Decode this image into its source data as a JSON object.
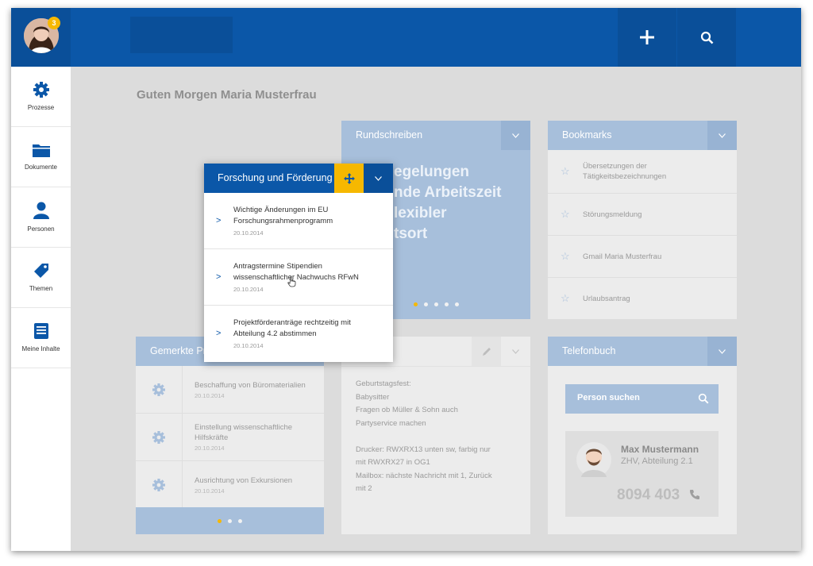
{
  "header": {
    "notification_count": "3",
    "add_icon": "plus-icon",
    "search_icon": "search-icon"
  },
  "sidebar": {
    "items": [
      {
        "label": "Prozesse",
        "icon": "gear-icon"
      },
      {
        "label": "Dokumente",
        "icon": "folder-icon"
      },
      {
        "label": "Personen",
        "icon": "person-icon"
      },
      {
        "label": "Themen",
        "icon": "tag-icon"
      },
      {
        "label": "Meine Inhalte",
        "icon": "inbox-icon"
      }
    ]
  },
  "greeting": "Guten Morgen Maria Musterfrau",
  "rundschreiben": {
    "title": "Rundschreiben",
    "teaser_lines": [
      "egelungen",
      "nde Arbeitszeit",
      "lexibler",
      "tsort"
    ],
    "carousel_active": 1,
    "carousel_count": 5
  },
  "bookmarks": {
    "title": "Bookmarks",
    "items": [
      {
        "label_line1": "Übersetzungen der",
        "label_line2": "Tätigkeitsbezeichnungen"
      },
      {
        "label_line1": "Störungsmeldung",
        "label_line2": ""
      },
      {
        "label_line1": "Gmail Maria Musterfrau",
        "label_line2": ""
      },
      {
        "label_line1": "Urlaubsantrag",
        "label_line2": ""
      }
    ]
  },
  "gemerkte": {
    "title": "Gemerkte Pro",
    "items": [
      {
        "title_line1": "Beschaffung von Büromaterialien",
        "title_line2": "",
        "date": "20.10.2014"
      },
      {
        "title_line1": "Einstellung wissenschaftliche",
        "title_line2": "Hilfskräfte",
        "date": "20.10.2014"
      },
      {
        "title_line1": "Ausrichtung von Exkursionen",
        "title_line2": "",
        "date": "20.10.2014"
      }
    ],
    "carousel_active": 1,
    "carousel_count": 3
  },
  "notes": {
    "lines": [
      "Geburtstagsfest:",
      "Babysitter",
      "Fragen ob Müller & Sohn auch",
      "Partyservice machen",
      "",
      "Drucker: RWXRX13 unten sw, farbig nur",
      "mit RWXRX27 in OG1",
      "Mailbox: nächste Nachricht mit 1, Zurück",
      "mit 2"
    ]
  },
  "telefonbuch": {
    "title": "Telefonbuch",
    "search_placeholder": "Person suchen",
    "contact": {
      "name": "Max Mustermann",
      "department": "ZHV, Abteilung 2.1",
      "phone": "8094 403"
    }
  },
  "popup": {
    "title": "Forschung und Förderung",
    "items": [
      {
        "title_line1": "Wichtige Änderungen im EU",
        "title_line2": "Forschungsrahmenprogramm",
        "date": "20.10.2014"
      },
      {
        "title_line1": "Antragstermine Stipendien",
        "title_line2": "wissenschaftlicher Nachwuchs RFwN",
        "date": "20.10.2014"
      },
      {
        "title_line1": "Projektförderanträge rechtzeitig mit",
        "title_line2": "Abteilung 4.2 abstimmen",
        "date": "20.10.2014"
      }
    ]
  },
  "colors": {
    "primary": "#0b57a8",
    "accent": "#f6b800",
    "card_header": "#a7bfdb",
    "background": "#dcdcdc"
  }
}
